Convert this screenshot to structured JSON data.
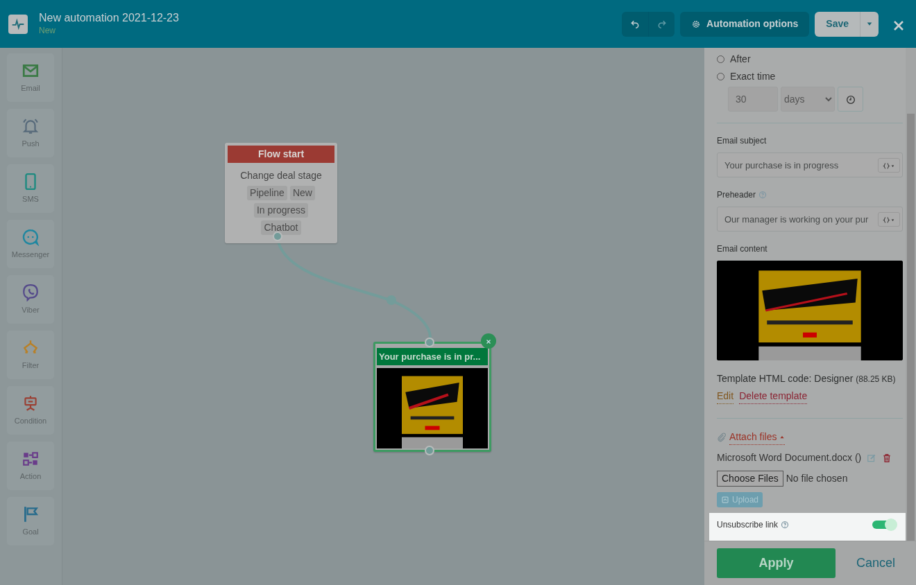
{
  "header": {
    "title": "New automation 2021-12-23",
    "status": "New",
    "undo": {
      "disabled": false
    },
    "redo": {
      "disabled": true
    },
    "options_button": "Automation options",
    "save_button": "Save"
  },
  "palette": [
    {
      "kind": "email",
      "label": "Email"
    },
    {
      "kind": "push",
      "label": "Push"
    },
    {
      "kind": "sms",
      "label": "SMS"
    },
    {
      "kind": "messenger",
      "label": "Messenger"
    },
    {
      "kind": "viber",
      "label": "Viber"
    },
    {
      "kind": "filter",
      "label": "Filter"
    },
    {
      "kind": "condition",
      "label": "Condition"
    },
    {
      "kind": "action",
      "label": "Action"
    },
    {
      "kind": "goal",
      "label": "Goal"
    }
  ],
  "canvas": {
    "nodes": [
      {
        "kind": "start",
        "title": "Flow start",
        "subtitle": "Change deal stage",
        "tags": [
          "Pipeline",
          "New",
          "In progress",
          "Chatbot"
        ],
        "selected": false
      },
      {
        "kind": "email",
        "title": "Your purchase is in pr...",
        "selected": true
      }
    ]
  },
  "panel": {
    "timing_options": [
      {
        "label": "After",
        "selected": false
      },
      {
        "label": "Exact time",
        "selected": false
      }
    ],
    "delay_value": "30",
    "delay_unit": "days",
    "subject": {
      "label": "Email subject",
      "value": "Your purchase is in progress"
    },
    "preheader": {
      "label": "Preheader",
      "value": "Our manager is working on your pur"
    },
    "content_label": "Email content",
    "template_info": "Template HTML code: Designer",
    "template_size": "(88.25 KB)",
    "edit_link": "Edit",
    "delete_link": "Delete template",
    "attach_label": "Attach files",
    "attach_expanded": true,
    "attachments": [
      "Microsoft Word Document.docx ()"
    ],
    "choose_button": "Choose Files",
    "no_file": "No file chosen",
    "upload_button": "Upload",
    "upload_disabled": true,
    "unsubscribe": {
      "label": "Unsubscribe link",
      "on": true
    }
  },
  "footer": {
    "apply": "Apply",
    "cancel": "Cancel"
  }
}
